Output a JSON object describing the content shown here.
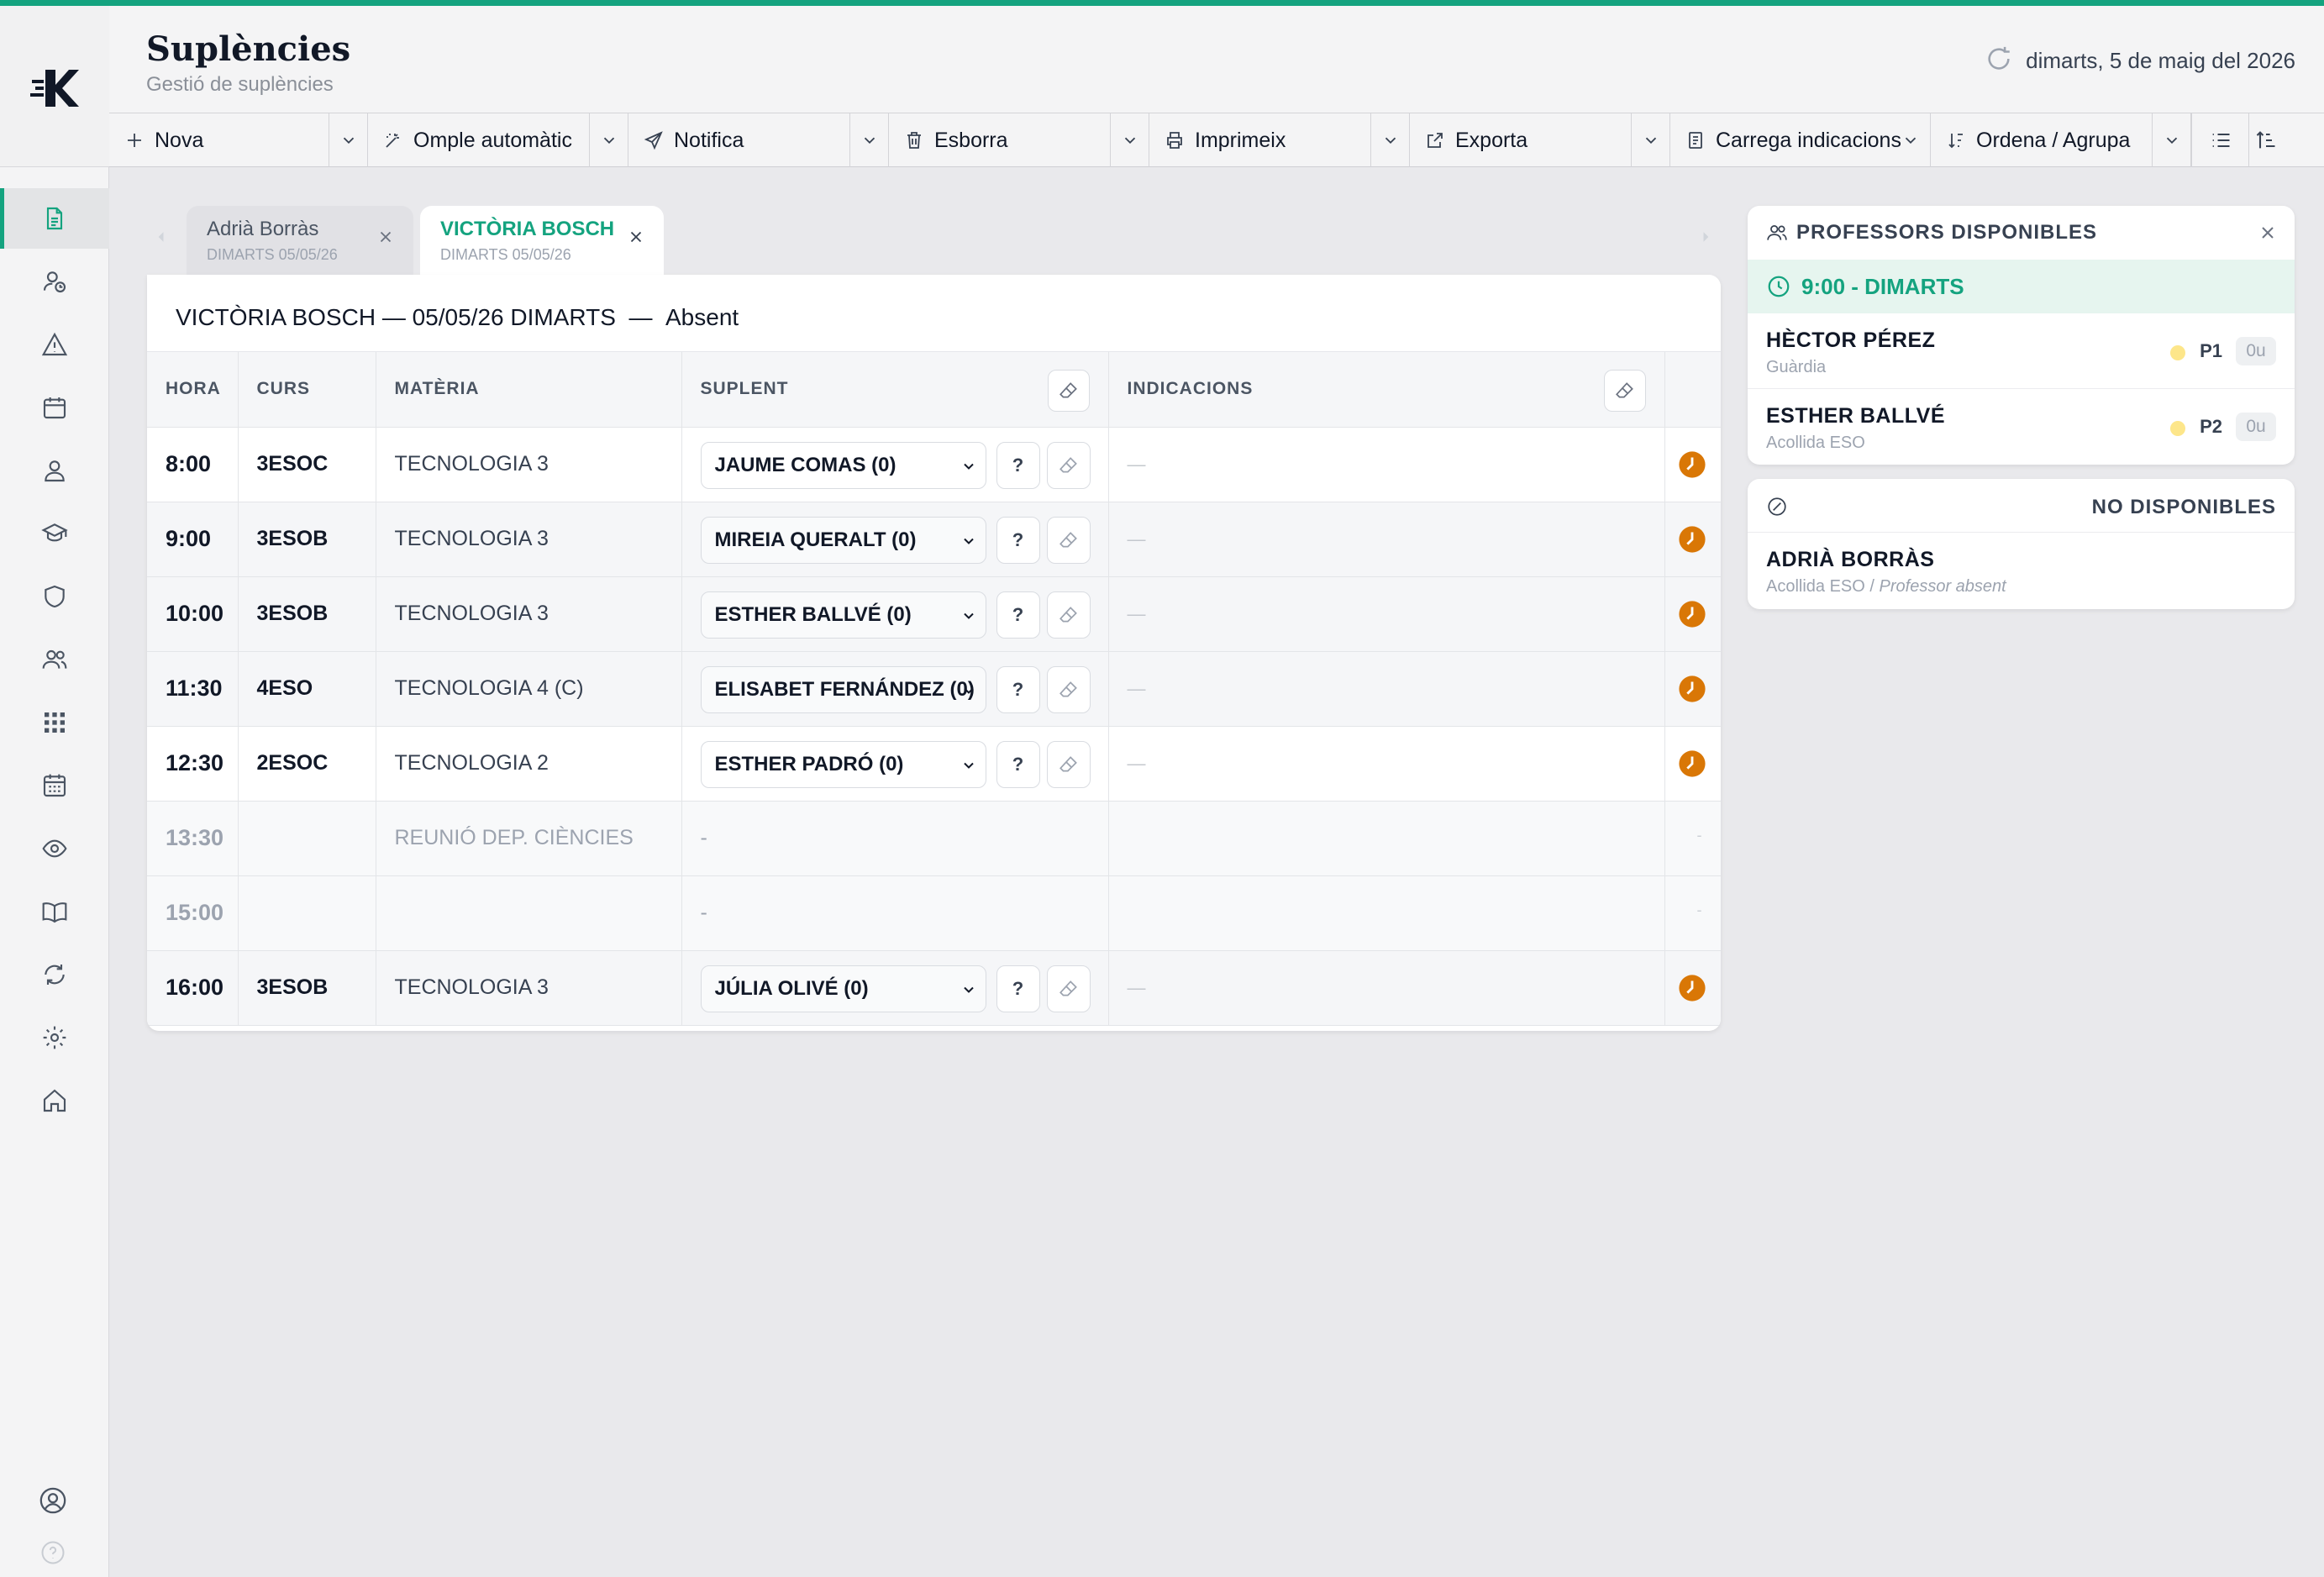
{
  "app": {
    "title": "Suplències",
    "subtitle": "Gestió de suplències",
    "date": "dimarts, 5 de maig del 2026"
  },
  "toolbar": {
    "buttons": [
      {
        "label": "Nova",
        "icon": "plus-icon"
      },
      {
        "label": "Omple automàtic",
        "icon": "magic-wand-icon"
      },
      {
        "label": "Notifica",
        "icon": "send-icon"
      },
      {
        "label": "Esborra",
        "icon": "trash-icon"
      },
      {
        "label": "Imprimeix",
        "icon": "printer-icon"
      },
      {
        "label": "Exporta",
        "icon": "external-link-icon"
      },
      {
        "label": "Carrega indicacions",
        "icon": "document-icon"
      },
      {
        "label": "Ordena / Agrupa",
        "icon": "sort-icon"
      }
    ]
  },
  "tabs": [
    {
      "name": "Adrià Borràs",
      "sub": "DIMARTS 05/05/26",
      "active": false
    },
    {
      "name": "VICTÒRIA BOSCH",
      "sub": "DIMARTS 05/05/26",
      "active": true
    }
  ],
  "card": {
    "title": "VICTÒRIA BOSCH — 05/05/26 DIMARTS",
    "separator": "—",
    "status": "Absent"
  },
  "table": {
    "headers": {
      "hora": "HORA",
      "curs": "CURS",
      "materia": "MATÈRIA",
      "suplent": "SUPLENT",
      "indicacions": "INDICACIONS"
    },
    "rows": [
      {
        "hora": "8:00",
        "curs": "3ESOC",
        "materia": "TECNOLOGIA 3",
        "suplent": "JAUME COMAS (0)",
        "help": "?",
        "indicacions": "—"
      },
      {
        "hora": "9:00",
        "curs": "3ESOB",
        "materia": "TECNOLOGIA 3",
        "suplent": "MIREIA QUERALT (0)",
        "help": "?",
        "indicacions": "—"
      },
      {
        "hora": "10:00",
        "curs": "3ESOB",
        "materia": "TECNOLOGIA 3",
        "suplent": "ESTHER BALLVÉ (0)",
        "help": "?",
        "indicacions": "—"
      },
      {
        "hora": "11:30",
        "curs": "4ESO",
        "materia": "TECNOLOGIA 4 (C)",
        "suplent": "ELISABET FERNÁNDEZ (0)",
        "help": "?",
        "indicacions": "—"
      },
      {
        "hora": "12:30",
        "curs": "2ESOC",
        "materia": "TECNOLOGIA 2",
        "suplent": "ESTHER PADRÓ (0)",
        "help": "?",
        "indicacions": "—"
      },
      {
        "hora": "13:30",
        "curs": "",
        "materia": "REUNIÓ DEP. CIÈNCIES",
        "suplent": "-",
        "indicacions": ""
      },
      {
        "hora": "15:00",
        "curs": "",
        "materia": "",
        "suplent": "-",
        "indicacions": ""
      },
      {
        "hora": "16:00",
        "curs": "3ESOB",
        "materia": "TECNOLOGIA 3",
        "suplent": "JÚLIA OLIVÉ (0)",
        "help": "?",
        "indicacions": "—"
      }
    ]
  },
  "available": {
    "title": "PROFESSORS DISPONIBLES",
    "slot": "9:00 - DIMARTS",
    "teachers": [
      {
        "name": "HÈCTOR PÉREZ",
        "role": "Guàrdia",
        "code": "P1",
        "hours": "0u"
      },
      {
        "name": "ESTHER BALLVÉ",
        "role": "Acollida ESO",
        "code": "P2",
        "hours": "0u"
      }
    ]
  },
  "unavailable": {
    "title": "NO DISPONIBLES",
    "teachers": [
      {
        "name": "ADRIÀ BORRÀS",
        "role": "Acollida ESO",
        "sep": " / ",
        "reason": "Professor absent"
      }
    ]
  },
  "colors": {
    "accent": "#14a37f",
    "clock": "#d97706",
    "slot_bg": "#e6f5ef"
  }
}
